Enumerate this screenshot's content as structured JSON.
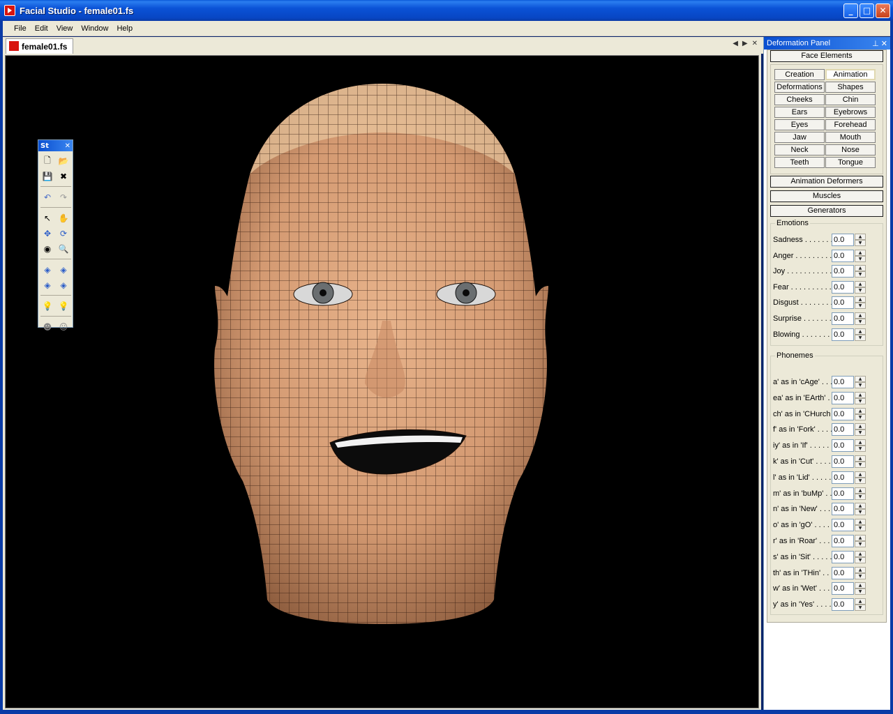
{
  "window": {
    "title": "Facial Studio - female01.fs"
  },
  "menu": [
    "File",
    "Edit",
    "View",
    "Window",
    "Help"
  ],
  "document_tab": {
    "label": "female01.fs"
  },
  "toolbar": {
    "title": "St"
  },
  "panel": {
    "title": "Deformation Panel",
    "face_elements_label": "Face Elements",
    "face_element_buttons": [
      "Creation",
      "Animation",
      "Deformations",
      "Shapes",
      "Cheeks",
      "Chin",
      "Ears",
      "Eyebrows",
      "Eyes",
      "Forehead",
      "Jaw",
      "Mouth",
      "Neck",
      "Nose",
      "Teeth",
      "Tongue"
    ],
    "active_button": "Animation",
    "animation_deformers_label": "Animation Deformers",
    "muscles_label": "Muscles",
    "generators_label": "Generators",
    "emotions": {
      "legend": "Emotions",
      "items": [
        {
          "label": "Sadness . . . . . . . .",
          "value": "0.0"
        },
        {
          "label": "Anger . . . . . . . . . .",
          "value": "0.0"
        },
        {
          "label": "Joy . . . . . . . . . . . .",
          "value": "0.0"
        },
        {
          "label": "Fear . . . . . . . . . . .",
          "value": "0.0"
        },
        {
          "label": "Disgust . . . . . . . . .",
          "value": "0.0"
        },
        {
          "label": "Surprise . . . . . . . .",
          "value": "0.0"
        },
        {
          "label": "Blowing . . . . . . . .",
          "value": "0.0"
        }
      ]
    },
    "phonemes": {
      "legend": "Phonemes",
      "items": [
        {
          "label": "a' as in 'cAge' . . .",
          "value": "0.0"
        },
        {
          "label": "ea' as in 'EArth' . .",
          "value": "0.0"
        },
        {
          "label": "ch' as in 'CHurch",
          "value": "0.0"
        },
        {
          "label": "f' as in 'Fork' . . . .",
          "value": "0.0"
        },
        {
          "label": "iy' as in 'If' . . . . . .",
          "value": "0.0"
        },
        {
          "label": "k' as in 'Cut' . . . . .",
          "value": "0.0"
        },
        {
          "label": "l' as in 'Lid' . . . . . .",
          "value": "0.0"
        },
        {
          "label": "m' as in 'buMp' . . .",
          "value": "0.0"
        },
        {
          "label": "n' as in 'New' . . . .",
          "value": "0.0"
        },
        {
          "label": "o' as in 'gO' . . . . .",
          "value": "0.0"
        },
        {
          "label": "r' as in 'Roar' . . . .",
          "value": "0.0"
        },
        {
          "label": "s' as in 'Sit' . . . . . .",
          "value": "0.0"
        },
        {
          "label": "th' as in 'THin' . . . .",
          "value": "0.0"
        },
        {
          "label": "w' as in 'Wet' . . . . .",
          "value": "0.0"
        },
        {
          "label": "y' as in 'Yes' . . . . .",
          "value": "0.0"
        }
      ]
    }
  },
  "icons": [
    "new-file-icon",
    "open-folder-icon",
    "save-icon",
    "close-file-icon",
    "undo-icon",
    "redo-icon",
    "select-arrow-icon",
    "pan-hand-icon",
    "move-icon",
    "rotate-icon",
    "orbit-icon",
    "zoom-icon",
    "view-front-icon",
    "view-side-icon",
    "view-top-icon",
    "view-persp-icon",
    "light-icon",
    "light-alt-icon",
    "head-icon",
    "face-icon"
  ],
  "colors": {
    "titlebar": "#0a52d6",
    "viewport_bg": "#000000",
    "skin": "#d9a07a",
    "wire": "#1a0d06"
  }
}
